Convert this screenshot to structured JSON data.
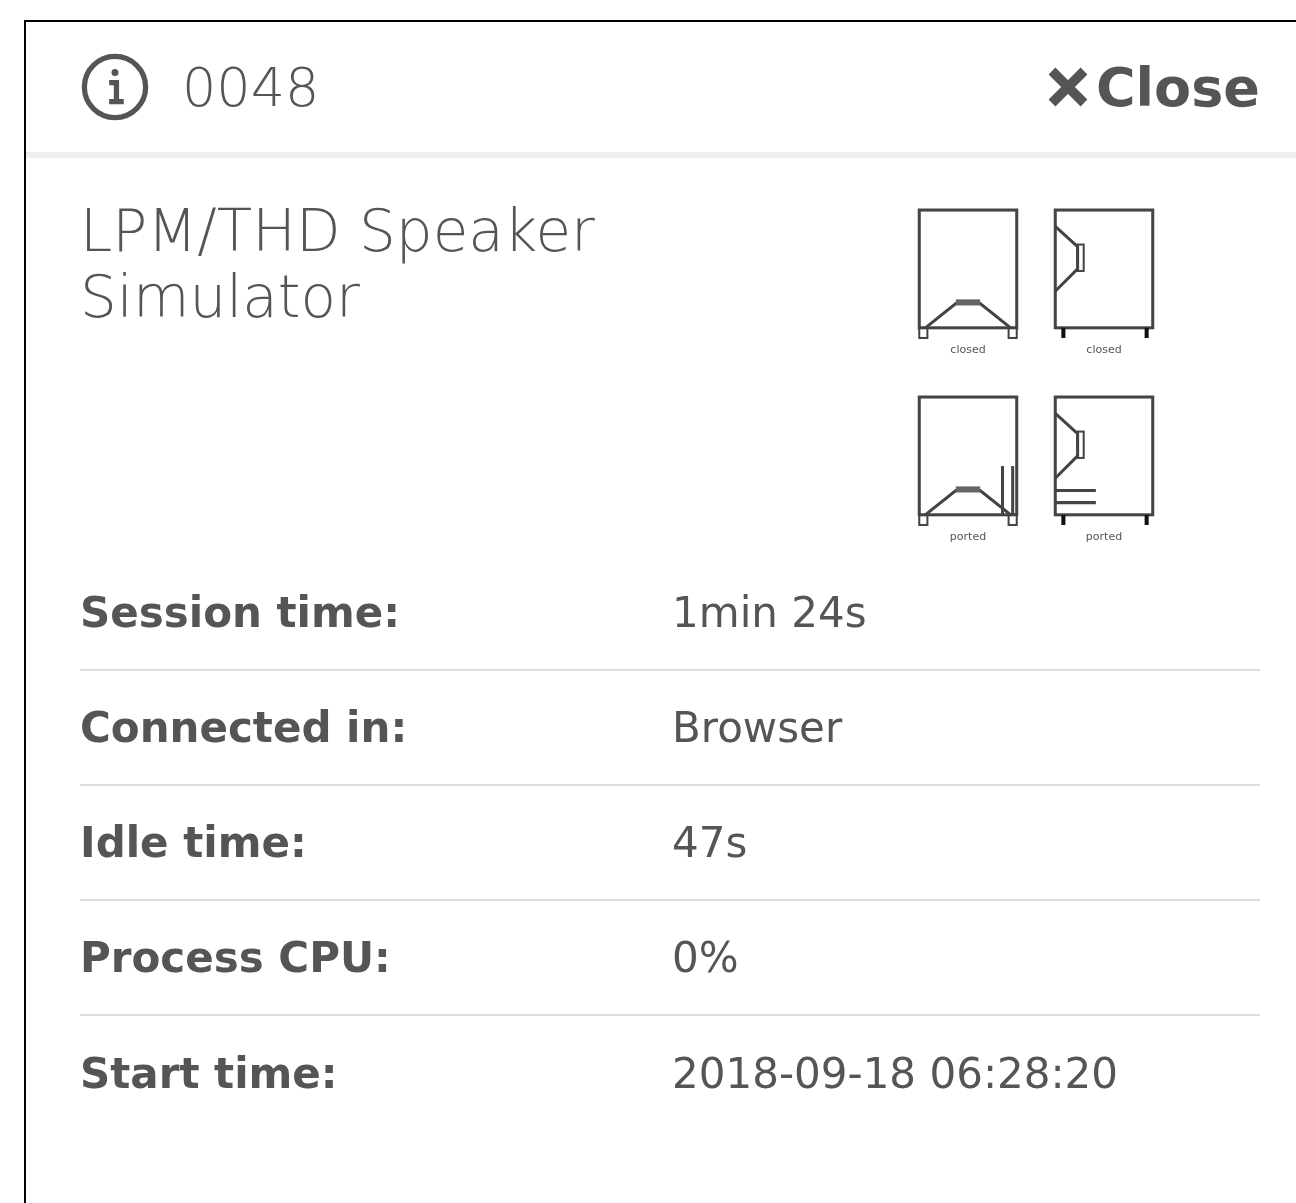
{
  "header": {
    "id": "0048",
    "close_label": "Close"
  },
  "title": "LPM/THD Speaker Simulator",
  "diagrams": [
    {
      "kind": "bottom",
      "ported": false,
      "caption": "closed"
    },
    {
      "kind": "side",
      "ported": false,
      "caption": "closed"
    },
    {
      "kind": "bottom",
      "ported": true,
      "caption": "ported"
    },
    {
      "kind": "side",
      "ported": true,
      "caption": "ported"
    }
  ],
  "details": [
    {
      "label": "Session time:",
      "value": "1min 24s"
    },
    {
      "label": "Connected in:",
      "value": "Browser"
    },
    {
      "label": "Idle time:",
      "value": "47s"
    },
    {
      "label": "Process CPU:",
      "value": "0%"
    },
    {
      "label": "Start time:",
      "value": "2018-09-18 06:28:20"
    }
  ]
}
